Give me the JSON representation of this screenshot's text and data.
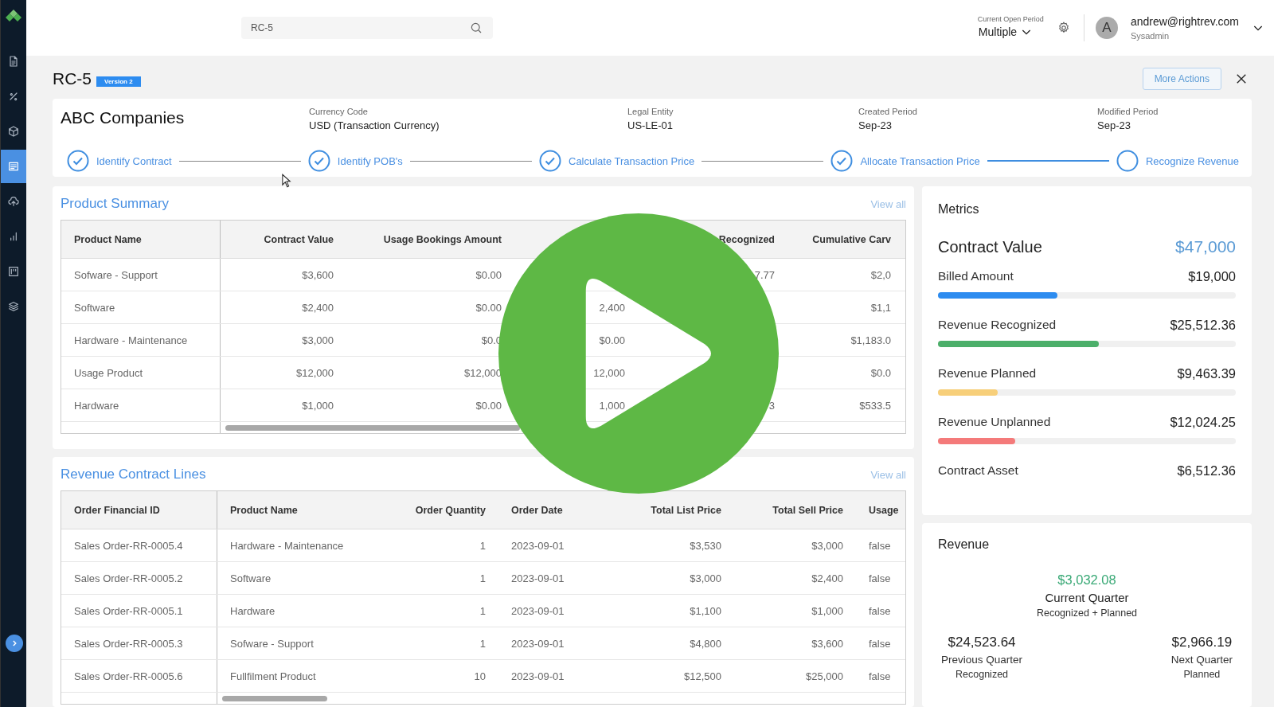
{
  "sidebar": {
    "items": [
      {
        "selected": false
      },
      {
        "selected": false
      },
      {
        "selected": false
      },
      {
        "selected": true
      },
      {
        "selected": false
      },
      {
        "selected": false
      },
      {
        "selected": false
      },
      {
        "selected": false
      }
    ]
  },
  "search": {
    "value": "RC-5"
  },
  "period": {
    "label": "Current Open Period",
    "value": "Multiple"
  },
  "user": {
    "avatar": "A",
    "email": "andrew@rightrev.com",
    "role": "Sysadmin"
  },
  "contract": {
    "id": "RC-5",
    "version": "Version 2",
    "customer": "ABC Companies",
    "more_actions": "More Actions",
    "fields": [
      {
        "label": "Currency Code",
        "value": "USD (Transaction Currency)"
      },
      {
        "label": "Legal Entity",
        "value": "US-LE-01"
      },
      {
        "label": "Created Period",
        "value": "Sep-23"
      },
      {
        "label": "Modified Period",
        "value": "Sep-23"
      }
    ]
  },
  "steps": [
    {
      "label": "Identify Contract",
      "done": true
    },
    {
      "label": "Identify POB's",
      "done": true
    },
    {
      "label": "Calculate Transaction Price",
      "done": true
    },
    {
      "label": "Allocate Transaction Price",
      "done": true
    },
    {
      "label": "Recognize Revenue",
      "done": false
    }
  ],
  "product_summary": {
    "title": "Product Summary",
    "view_all": "View all",
    "columns": [
      "Product Name",
      "Contract Value",
      "Usage Bookings Amount",
      null,
      "Recognized",
      "Cumulative Carv"
    ],
    "rows": [
      [
        "Sofware - Support",
        "$3,600",
        "$0.00",
        null,
        "7.77",
        "$2,0"
      ],
      [
        "Software",
        "$2,400",
        "$0.00",
        "2,400",
        null,
        "$1,1"
      ],
      [
        "Hardware - Maintenance",
        "$3,000",
        "$0.0",
        "$0.00",
        null,
        "$1,183.0"
      ],
      [
        "Usage Product",
        "$12,000",
        "$12,000",
        "12,000",
        null,
        "$0.0"
      ],
      [
        "Hardware",
        "$1,000",
        "$0.00",
        "1,000",
        "3",
        "$533.5"
      ]
    ]
  },
  "revenue_lines": {
    "title": "Revenue Contract Lines",
    "view_all": "View all",
    "columns": [
      "Order Financial ID",
      "Product Name",
      "Order Quantity",
      "Order Date",
      "Total List Price",
      "Total Sell Price",
      "Usage"
    ],
    "rows": [
      [
        "Sales Order-RR-0005.4",
        "Hardware - Maintenance",
        "1",
        "2023-09-01",
        "$3,530",
        "$3,000",
        "false"
      ],
      [
        "Sales Order-RR-0005.2",
        "Software",
        "1",
        "2023-09-01",
        "$3,000",
        "$2,400",
        "false"
      ],
      [
        "Sales Order-RR-0005.1",
        "Hardware",
        "1",
        "2023-09-01",
        "$1,100",
        "$1,000",
        "false"
      ],
      [
        "Sales Order-RR-0005.3",
        "Sofware - Support",
        "1",
        "2023-09-01",
        "$4,800",
        "$3,600",
        "false"
      ],
      [
        "Sales Order-RR-0005.6",
        "Fullfilment Product",
        "10",
        "2023-09-01",
        "$12,500",
        "$25,000",
        "false"
      ]
    ]
  },
  "metrics": {
    "title": "Metrics",
    "contract_value": {
      "label": "Contract Value",
      "value": "$47,000"
    },
    "items": [
      {
        "kind": "bar",
        "label": "Billed Amount",
        "value": "$19,000",
        "level": 0.4,
        "color": "#2d8cf0"
      },
      {
        "kind": "bar",
        "label": "Revenue Recognized",
        "value": "$25,512.36",
        "level": 0.54,
        "color": "#4caf6a"
      },
      {
        "kind": "bar",
        "label": "Revenue Planned",
        "value": "$9,463.39",
        "level": 0.2,
        "color": "#f7cf7a"
      },
      {
        "kind": "bar",
        "label": "Revenue Unplanned",
        "value": "$12,024.25",
        "level": 0.26,
        "color": "#f47a7a"
      },
      {
        "kind": "plain",
        "label": "Contract Asset",
        "value": "$6,512.36"
      }
    ]
  },
  "revenue": {
    "title": "Revenue",
    "current": {
      "value": "$3,032.08",
      "label": "Current Quarter",
      "sub": "Recognized + Planned"
    },
    "previous": {
      "value": "$24,523.64",
      "label": "Previous Quarter",
      "sub": "Recognized"
    },
    "next": {
      "value": "$2,966.19",
      "label": "Next Quarter",
      "sub": "Planned"
    }
  }
}
